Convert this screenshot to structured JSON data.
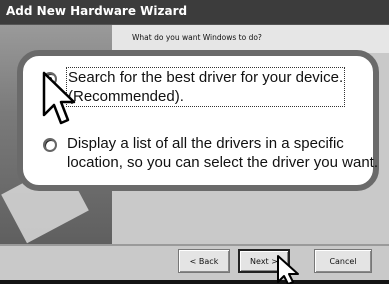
{
  "window": {
    "title": "Add New Hardware Wizard"
  },
  "wizard": {
    "question": "What do you want Windows to do?",
    "options": [
      {
        "line1": "Search for the best driver for your device.",
        "line2": "(Recommended).",
        "selected": true
      },
      {
        "line1": "Display a list of all the drivers in a specific",
        "line2": "location, so you can select the driver you want.",
        "selected": false
      }
    ]
  },
  "buttons": {
    "back": "< Back",
    "next": "Next >",
    "cancel": "Cancel"
  },
  "colors": {
    "callout_border": "#6a6a6a",
    "dialog_face": "#c9c9c9",
    "titlebar": "#3c3c3c"
  },
  "icons": {
    "pointer": "arrow-cursor-icon"
  }
}
